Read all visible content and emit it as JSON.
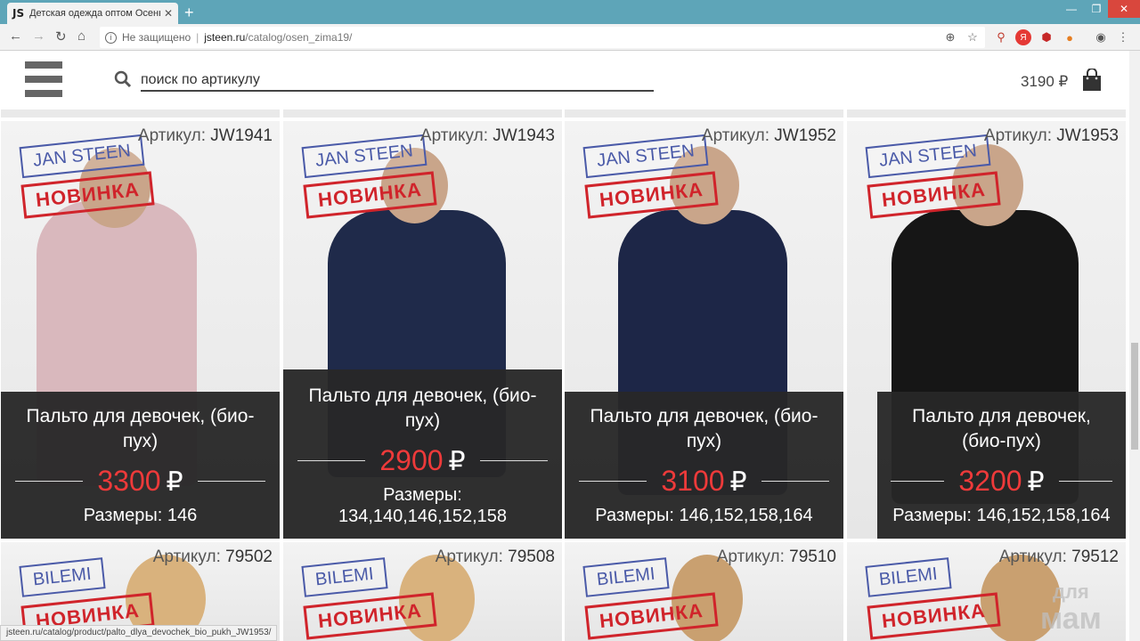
{
  "browser": {
    "tab_title": "Детская одежда оптом Осень-З",
    "tab_favicon": "JS",
    "security_label": "Не защищено",
    "url_host": "jsteen.ru",
    "url_path": "/catalog/osen_zima19/",
    "status_url": "jsteen.ru/catalog/product/palto_dlya_devochek_bio_pukh_JW1953/"
  },
  "header": {
    "search_placeholder": "поиск по артикулу",
    "cart_total": "3190 ₽"
  },
  "colors": {
    "price": "#ee3a3a",
    "panel": "#282828",
    "stamp_brand": "#4a5aa8",
    "stamp_new": "#d0242b",
    "chrome_tabbar": "#5ea5b8"
  },
  "products": [
    {
      "article_label": "Артикул:",
      "article": "JW1941",
      "brand": "JAN STEEN",
      "badge": "НОВИНКА",
      "name": "Пальто для девочек, (био-пух)",
      "price": "3300",
      "currency": "₽",
      "sizes_label": "Размеры:",
      "sizes": "146"
    },
    {
      "article_label": "Артикул:",
      "article": "JW1943",
      "brand": "JAN STEEN",
      "badge": "НОВИНКА",
      "name": "Пальто для девочек, (био-пух)",
      "price": "2900",
      "currency": "₽",
      "sizes_label": "Размеры:",
      "sizes": "134,140,146,152,158"
    },
    {
      "article_label": "Артикул:",
      "article": "JW1952",
      "brand": "JAN STEEN",
      "badge": "НОВИНКА",
      "name": "Пальто для девочек, (био-пух)",
      "price": "3100",
      "currency": "₽",
      "sizes_label": "Размеры:",
      "sizes": "146,152,158,164"
    },
    {
      "article_label": "Артикул:",
      "article": "JW1953",
      "brand": "JAN STEEN",
      "badge": "НОВИНКА",
      "name": "Пальто для девочек, (био-пух)",
      "price": "3200",
      "currency": "₽",
      "sizes_label": "Размеры:",
      "sizes": "146,152,158,164"
    }
  ],
  "products_row2": [
    {
      "article_label": "Артикул:",
      "article": "79502",
      "brand": "BILEMI",
      "badge": "НОВИНКА"
    },
    {
      "article_label": "Артикул:",
      "article": "79508",
      "brand": "BILEMI",
      "badge": "НОВИНКА"
    },
    {
      "article_label": "Артикул:",
      "article": "79510",
      "brand": "BILEMI",
      "badge": "НОВИНКА"
    },
    {
      "article_label": "Артикул:",
      "article": "79512",
      "brand": "BILEMI",
      "badge": "НОВИНКА"
    }
  ],
  "watermark": {
    "line1": "для",
    "line2": "мам"
  }
}
